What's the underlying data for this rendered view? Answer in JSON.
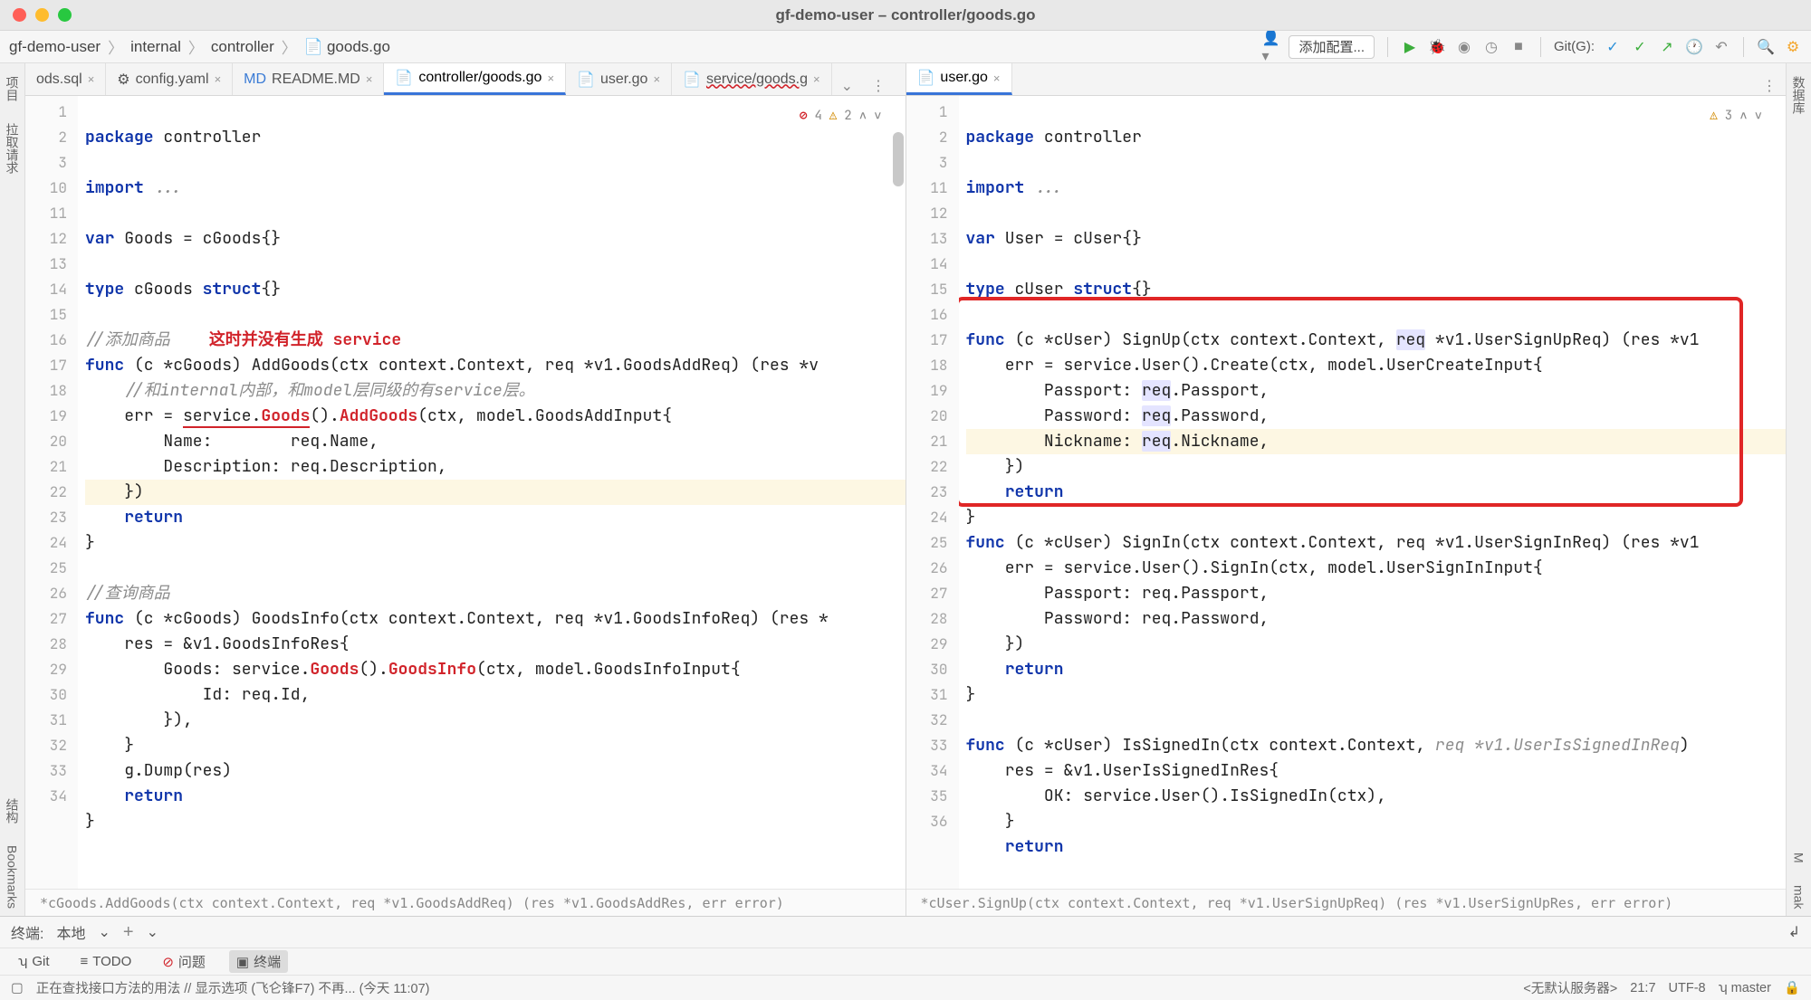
{
  "window": {
    "title": "gf-demo-user – controller/goods.go"
  },
  "breadcrumbs": {
    "root": "gf-demo-user",
    "p1": "internal",
    "p2": "controller",
    "file": "goods.go"
  },
  "toolbar": {
    "add_config": "添加配置...",
    "git_label": "Git(G):"
  },
  "tabs_left": {
    "t0": "ods.sql",
    "t1": "config.yaml",
    "t2": "README.MD",
    "t3": "controller/goods.go",
    "t4": "user.go",
    "t5": "service/goods.g"
  },
  "tabs_right": {
    "t0": "user.go"
  },
  "inspections": {
    "left_err": "4",
    "left_warn": "2",
    "right_warn": "3"
  },
  "left_gutter": [
    "1",
    "2",
    "3",
    "10",
    "11",
    "12",
    "13",
    "14",
    "15",
    "16",
    "17",
    "18",
    "19",
    "20",
    "21",
    "22",
    "23",
    "24",
    "25",
    "26",
    "27",
    "28",
    "29",
    "30",
    "31",
    "32",
    "33",
    "34"
  ],
  "right_gutter": [
    "1",
    "2",
    "3",
    "11",
    "12",
    "13",
    "14",
    "15",
    "16",
    "17",
    "18",
    "19",
    "20",
    "21",
    "22",
    "23",
    "24",
    "25",
    "26",
    "27",
    "28",
    "29",
    "30",
    "31",
    "32",
    "33",
    "34",
    "35",
    "36"
  ],
  "code_left": {
    "l1a": "package",
    "l1b": " controller",
    "l3a": "import",
    "l3b": " ...",
    "l5a": "var",
    "l5b": " Goods = cGoods{}",
    "l6a": "type",
    "l6b": " cGoods ",
    "l6c": "struct",
    "l6d": "{}",
    "l8": "//添加商品",
    "anno": "这时并没有生成 service",
    "l9a": "func",
    "l9b": " (c *cGoods) AddGoods(ctx context.Context, req *v1.GoodsAddReq) (res *v",
    "l10": "    //和internal内部，和model层同级的有service层。",
    "l11a": "    err = ",
    "l11b": "service.",
    "l11c": "Goods",
    "l11d": "().",
    "l11e": "AddGoods",
    "l11f": "(ctx, model.GoodsAddInput{",
    "l12": "        Name:        req.Name,",
    "l13": "        Description: req.Description,",
    "l14": "    })",
    "l15a": "    ",
    "l15b": "return",
    "l16": "}",
    "l18": "//查询商品",
    "l19a": "func",
    "l19b": " (c *cGoods) GoodsInfo(ctx context.Context, req *v1.GoodsInfoReq) (res *",
    "l20": "    res = &v1.GoodsInfoRes{",
    "l21a": "        Goods: service.",
    "l21b": "Goods",
    "l21c": "().",
    "l21d": "GoodsInfo",
    "l21e": "(ctx, model.GoodsInfoInput{",
    "l22": "            Id: req.Id,",
    "l23": "        }),",
    "l24": "    }",
    "l25": "    g.Dump(res)",
    "l26a": "    ",
    "l26b": "return",
    "l27": "}"
  },
  "code_right": {
    "l1a": "package",
    "l1b": " controller",
    "l3a": "import",
    "l3b": " ...",
    "l5a": "var",
    "l5b": " User = cUser{}",
    "l6a": "type",
    "l6b": " cUser ",
    "l6c": "struct",
    "l6d": "{}",
    "l8a": "func",
    "l8b": " (c *cUser) SignUp(ctx context.Context, ",
    "l8c": "req",
    "l8d": " *v1.UserSignUpReq) (res *v1",
    "l9": "    err = service.User().Create(ctx, model.UserCreateInput{",
    "l10a": "        Passport: ",
    "l10b": "req",
    "l10c": ".Passport,",
    "l11a": "        Password: ",
    "l11b": "req",
    "l11c": ".Password,",
    "l12a": "        Nickname: ",
    "l12b": "req",
    "l12c": ".Nickname,",
    "l13": "    })",
    "l14a": "    ",
    "l14b": "return",
    "l15": "}",
    "l16a": "func",
    "l16b": " (c *cUser) SignIn(ctx context.Context, req *v1.UserSignInReq) (res *v1",
    "l17": "    err = service.User().SignIn(ctx, model.UserSignInInput{",
    "l18": "        Passport: req.Passport,",
    "l19": "        Password: req.Password,",
    "l20": "    })",
    "l21a": "    ",
    "l21b": "return",
    "l22": "}",
    "l24a": "func",
    "l24b": " (c *cUser) IsSignedIn(ctx context.Context, ",
    "l24c": "req *v1.UserIsSignedInReq",
    "l24d": ")",
    "l25": "    res = &v1.UserIsSignedInRes{",
    "l26": "        OK: service.User().IsSignedIn(ctx),",
    "l27": "    }",
    "l28a": "    ",
    "l28b": "return"
  },
  "fn_crumb": {
    "left": "*cGoods.AddGoods(ctx context.Context, req *v1.GoodsAddReq) (res *v1.GoodsAddRes, err error)",
    "right": "*cUser.SignUp(ctx context.Context, req *v1.UserSignUpReq) (res *v1.UserSignUpRes, err error)"
  },
  "left_side": {
    "proj": "项目",
    "pull": "拉取请求",
    "struct": "结构",
    "book": "Bookmarks"
  },
  "right_side": {
    "db": "数据库",
    "m": "M",
    "mak": "mak"
  },
  "terminal": {
    "label": "终端:",
    "local": "本地"
  },
  "tool_windows": {
    "git": "Git",
    "todo": "TODO",
    "problems": "问题",
    "terminal": "终端"
  },
  "status": {
    "msg": "正在查找接口方法的用法 // 显示选项 (飞仑锋F7)   不再...  (今天 11:07)",
    "pos": "21:7",
    "enc": "UTF-8",
    "branch": "master",
    "server": "<无默认服务器>"
  }
}
